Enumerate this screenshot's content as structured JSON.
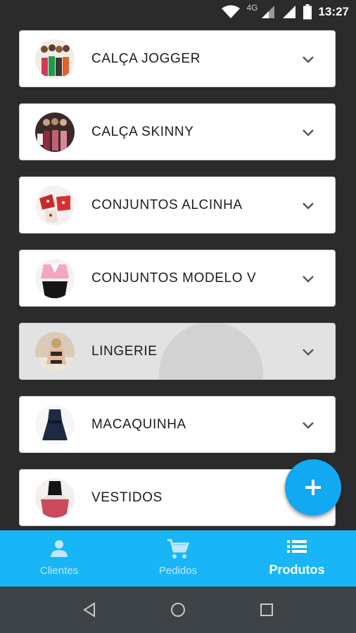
{
  "status_bar": {
    "network": "4G",
    "time": "13:27"
  },
  "categories": [
    {
      "label": "CALÇA JOGGER"
    },
    {
      "label": "CALÇA SKINNY"
    },
    {
      "label": "CONJUNTOS ALCINHA"
    },
    {
      "label": "CONJUNTOS MODELO V"
    },
    {
      "label": "LINGERIE"
    },
    {
      "label": "MACAQUINHA"
    },
    {
      "label": "VESTIDOS"
    }
  ],
  "fab": {
    "icon": "plus-icon"
  },
  "bottom_nav": {
    "items": [
      {
        "label": "Clientes",
        "icon": "person-icon"
      },
      {
        "label": "Pedidos",
        "icon": "cart-icon"
      },
      {
        "label": "Produtos",
        "icon": "list-icon",
        "active": true
      }
    ]
  },
  "colors": {
    "accent": "#18b5f7",
    "fab": "#12a9f3",
    "background": "#2b2b2b"
  }
}
